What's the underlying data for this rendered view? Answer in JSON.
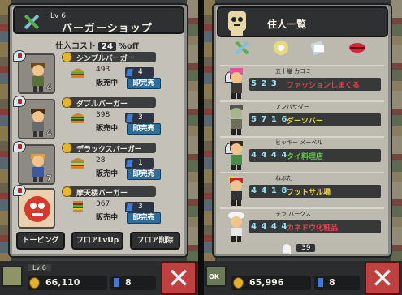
{
  "shop": {
    "level": "Lv 6",
    "title": "バーガーショップ",
    "cost_label": "仕入コスト",
    "cost_value": "24",
    "cost_suffix": "%off",
    "items": [
      {
        "name": "シンプルバーガー",
        "count": "493",
        "status": "販売中",
        "gems": "4",
        "button": "即完売",
        "char_level": "4"
      },
      {
        "name": "ダブルバーガー",
        "count": "398",
        "status": "販売中",
        "gems": "3",
        "button": "即完売",
        "char_level": "4"
      },
      {
        "name": "デラックスバーガー",
        "count": "28",
        "status": "販売中",
        "gems": "1",
        "button": "即完売",
        "char_level": "7"
      },
      {
        "name": "摩天楼バーガー",
        "count": "367",
        "status": "販売中",
        "gems": "3",
        "button": "即完売",
        "char_level": ""
      }
    ],
    "actions": [
      "トーピング",
      "フロアLvUp",
      "フロア削除"
    ],
    "bottom": {
      "level": "Lv 6",
      "money": "66,110",
      "gems": "8"
    }
  },
  "residents": {
    "title": "住人一覧",
    "tabs": [
      "work-icon",
      "food-icon",
      "books-icon",
      "lips-icon"
    ],
    "list": [
      {
        "name": "五十嵐 カヨミ",
        "stats": "5 2 3",
        "level": "9",
        "job": "ファッションしまくる",
        "job_color": "#e0434a"
      },
      {
        "name": "アンバサダー",
        "stats": "5 7 1 6",
        "level": "",
        "job": "ダーツバー",
        "job_color": "#e8d54a"
      },
      {
        "name": "ヒッキー メーベル",
        "stats": "4 4 4 4",
        "level": "",
        "job": "タイ料理店",
        "job_color": "#5fc24a"
      },
      {
        "name": "ねぶた",
        "stats": "4 4 1 8",
        "level": "",
        "job": "フットサル場",
        "job_color": "#e8d54a"
      },
      {
        "name": "テラ バークス",
        "stats": "4 4 4 4",
        "level": "",
        "job": "カネドウ化粧品",
        "job_color": "#e0434a"
      }
    ],
    "page": "39",
    "bottom": {
      "ok": "OK",
      "money": "65,996",
      "gems": "8"
    }
  }
}
